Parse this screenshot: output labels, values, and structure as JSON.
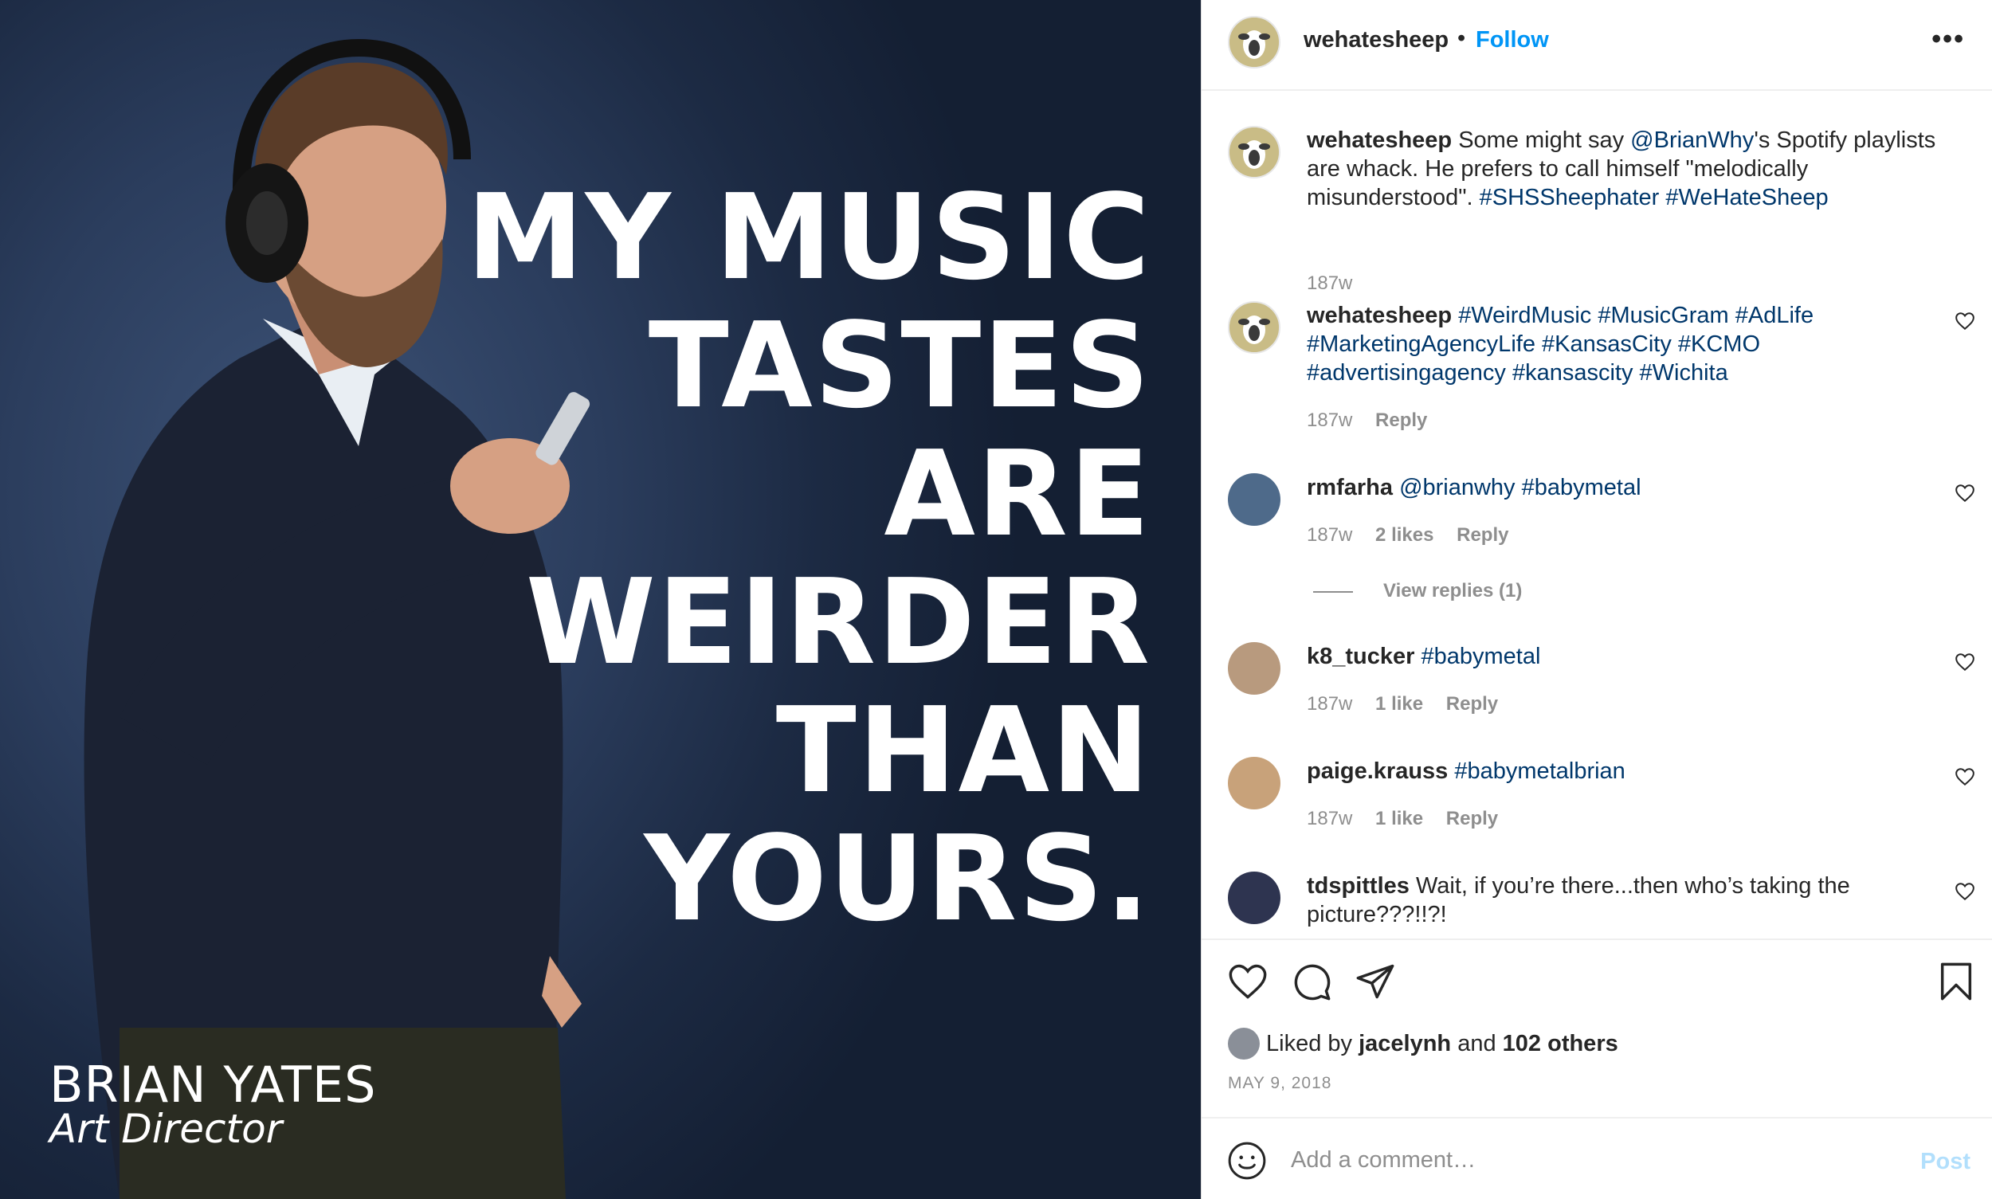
{
  "post_image": {
    "headline_lines": [
      "MY MUSIC",
      "TASTES",
      "ARE",
      "WEIRDER",
      "THAN",
      "YOURS."
    ],
    "person_name": "BRIAN YATES",
    "person_role": "Art Director"
  },
  "header": {
    "username": "wehatesheep",
    "separator": "•",
    "follow_label": "Follow",
    "more_label": "•••"
  },
  "comments": [
    {
      "avatar": "sheep-logo",
      "username": "wehatesheep",
      "parts": [
        {
          "t": "text",
          "v": " Some might say "
        },
        {
          "t": "tag",
          "v": "@BrianWhy"
        },
        {
          "t": "text",
          "v": "'s Spotify playlists are whack. He prefers to call himself \"melodically misunderstood\". "
        },
        {
          "t": "tag",
          "v": "#SHSSheephater"
        },
        {
          "t": "text",
          "v": " "
        },
        {
          "t": "tag",
          "v": "#WeHateSheep"
        }
      ],
      "time": "187w"
    },
    {
      "avatar": "sheep-logo",
      "username": "wehatesheep",
      "parts": [
        {
          "t": "text",
          "v": " "
        },
        {
          "t": "tag",
          "v": "#WeirdMusic"
        },
        {
          "t": "text",
          "v": " "
        },
        {
          "t": "tag",
          "v": "#MusicGram"
        },
        {
          "t": "text",
          "v": " "
        },
        {
          "t": "tag",
          "v": "#AdLife"
        },
        {
          "t": "text",
          "v": " "
        },
        {
          "t": "tag",
          "v": "#MarketingAgencyLife"
        },
        {
          "t": "text",
          "v": " "
        },
        {
          "t": "tag",
          "v": "#KansasCity"
        },
        {
          "t": "text",
          "v": " "
        },
        {
          "t": "tag",
          "v": "#KCMO"
        },
        {
          "t": "text",
          "v": " "
        },
        {
          "t": "tag",
          "v": "#advertisingagency"
        },
        {
          "t": "text",
          "v": " "
        },
        {
          "t": "tag",
          "v": "#kansascity"
        },
        {
          "t": "text",
          "v": " "
        },
        {
          "t": "tag",
          "v": "#Wichita"
        }
      ],
      "time": "187w",
      "reply_label": "Reply"
    },
    {
      "avatar": "user-photo",
      "username": "rmfarha",
      "parts": [
        {
          "t": "text",
          "v": " "
        },
        {
          "t": "tag",
          "v": "@brianwhy"
        },
        {
          "t": "text",
          "v": " "
        },
        {
          "t": "tag",
          "v": "#babymetal"
        }
      ],
      "time": "187w",
      "likes": "2 likes",
      "reply_label": "Reply",
      "view_replies": "View replies (1)"
    },
    {
      "avatar": "user-photo",
      "username": "k8_tucker",
      "parts": [
        {
          "t": "text",
          "v": " "
        },
        {
          "t": "tag",
          "v": "#babymetal"
        }
      ],
      "time": "187w",
      "likes": "1 like",
      "reply_label": "Reply"
    },
    {
      "avatar": "user-photo",
      "username": "paige.krauss",
      "parts": [
        {
          "t": "text",
          "v": " "
        },
        {
          "t": "tag",
          "v": "#babymetalbrian"
        }
      ],
      "time": "187w",
      "likes": "1 like",
      "reply_label": "Reply"
    },
    {
      "avatar": "user-photo",
      "username": "tdspittles",
      "parts": [
        {
          "t": "text",
          "v": " Wait, if you’re there...then who’s taking the picture???!!?!"
        }
      ]
    }
  ],
  "actions": {
    "liked_prefix": "Liked by ",
    "liked_user": "jacelynh",
    "liked_and": " and ",
    "liked_others": "102 others",
    "date": "MAY 9, 2018",
    "icons": [
      "heart-icon",
      "comment-icon",
      "share-icon",
      "bookmark-icon"
    ]
  },
  "add_comment": {
    "placeholder": "Add a comment…",
    "post_label": "Post"
  },
  "colors": {
    "link": "#00376b",
    "follow": "#0095f6",
    "post_disabled": "#b2dffc",
    "meta": "#8e8e8e"
  }
}
